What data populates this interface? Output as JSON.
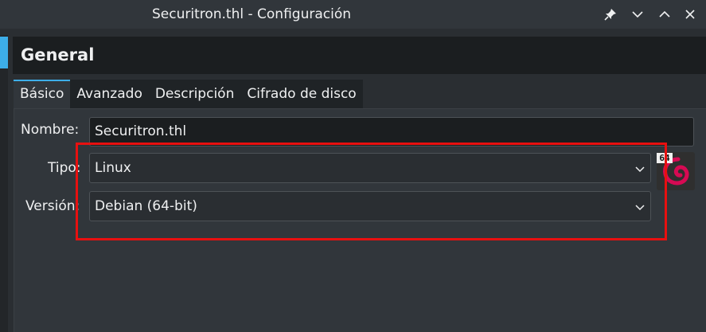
{
  "window": {
    "title": "Securitron.thl - Configuración"
  },
  "header": {
    "title": "General"
  },
  "tabs": [
    {
      "label": "Básico",
      "active": true
    },
    {
      "label": "Avanzado",
      "active": false
    },
    {
      "label": "Descripción",
      "active": false
    },
    {
      "label": "Cifrado de disco",
      "active": false
    }
  ],
  "form": {
    "name_label": "Nombre:",
    "name_value": "Securitron.thl",
    "type_label": "Tipo:",
    "type_value": "Linux",
    "version_label": "Versión:",
    "version_value": "Debian (64-bit)"
  },
  "os_icon": {
    "badge": "64",
    "icon": "debian-swirl-icon",
    "color": "#d70a53"
  },
  "colors": {
    "accent": "#3daee9",
    "highlight": "#e81010"
  }
}
